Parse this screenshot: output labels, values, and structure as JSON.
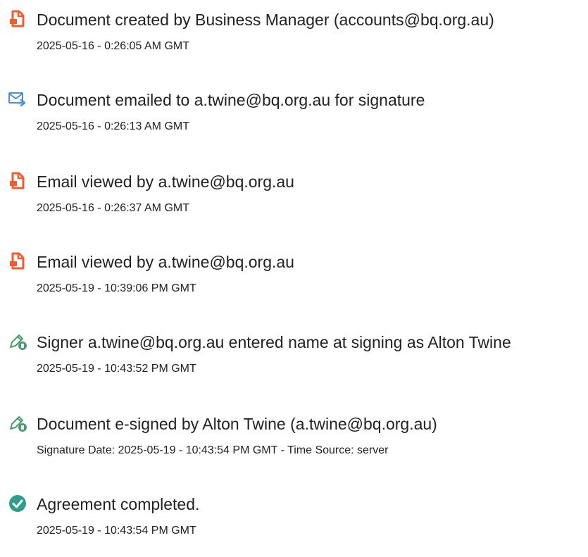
{
  "colors": {
    "pdf_icon": "#f25c2e",
    "email_icon": "#4a90d9",
    "signer_icon": "#4a9d6b",
    "check_icon": "#2d9f8c"
  },
  "events": [
    {
      "icon": "document-icon",
      "title": "Document created by Business Manager (accounts@bq.org.au)",
      "detail": "2025-05-16 - 0:26:05 AM GMT"
    },
    {
      "icon": "email-send-icon",
      "title": "Document emailed to a.twine@bq.org.au for signature",
      "detail": "2025-05-16 - 0:26:13 AM GMT"
    },
    {
      "icon": "document-icon",
      "title": "Email viewed by a.twine@bq.org.au",
      "detail": "2025-05-16 - 0:26:37 AM GMT"
    },
    {
      "icon": "document-icon",
      "title": "Email viewed by a.twine@bq.org.au",
      "detail": "2025-05-19 - 10:39:06 PM GMT"
    },
    {
      "icon": "pen-signer-icon",
      "title": "Signer a.twine@bq.org.au entered name at signing as Alton Twine",
      "detail": "2025-05-19 - 10:43:52 PM GMT"
    },
    {
      "icon": "pen-signer-icon",
      "title": "Document e-signed by Alton Twine (a.twine@bq.org.au)",
      "detail": "Signature Date: 2025-05-19 - 10:43:54 PM GMT - Time Source: server"
    },
    {
      "icon": "check-circle-icon",
      "title": "Agreement completed.",
      "detail": "2025-05-19 - 10:43:54 PM GMT"
    }
  ]
}
